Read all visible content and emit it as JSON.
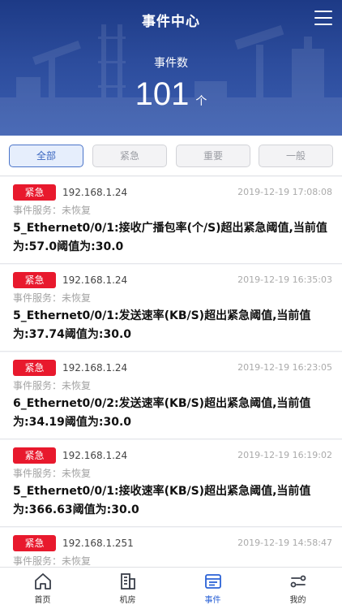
{
  "header": {
    "title": "事件中心",
    "count_label": "事件数",
    "count_value": "101",
    "count_unit": "个"
  },
  "filters": [
    {
      "label": "全部",
      "active": true
    },
    {
      "label": "紧急",
      "active": false
    },
    {
      "label": "重要",
      "active": false
    },
    {
      "label": "一般",
      "active": false
    }
  ],
  "events": [
    {
      "level": "紧急",
      "ip": "192.168.1.24",
      "time": "2019-12-19 17:08:08",
      "service": "事件服务：未恢复",
      "message": "5_Ethernet0/0/1:接收广播包率(个/S)超出紧急阈值,当前值为:57.0阈值为:30.0"
    },
    {
      "level": "紧急",
      "ip": "192.168.1.24",
      "time": "2019-12-19 16:35:03",
      "service": "事件服务：未恢复",
      "message": "5_Ethernet0/0/1:发送速率(KB/S)超出紧急阈值,当前值为:37.74阈值为:30.0"
    },
    {
      "level": "紧急",
      "ip": "192.168.1.24",
      "time": "2019-12-19 16:23:05",
      "service": "事件服务：未恢复",
      "message": "6_Ethernet0/0/2:发送速率(KB/S)超出紧急阈值,当前值为:34.19阈值为:30.0"
    },
    {
      "level": "紧急",
      "ip": "192.168.1.24",
      "time": "2019-12-19 16:19:02",
      "service": "事件服务：未恢复",
      "message": "5_Ethernet0/0/1:接收速率(KB/S)超出紧急阈值,当前值为:366.63阈值为:30.0"
    },
    {
      "level": "紧急",
      "ip": "192.168.1.251",
      "time": "2019-12-19 14:58:47",
      "service": "事件服务：未恢复",
      "message": ""
    }
  ],
  "tabbar": [
    {
      "label": "首页",
      "icon": "home-icon",
      "active": false
    },
    {
      "label": "机房",
      "icon": "building-icon",
      "active": false
    },
    {
      "label": "事件",
      "icon": "event-list-icon",
      "active": true
    },
    {
      "label": "我的",
      "icon": "profile-settings-icon",
      "active": false
    }
  ],
  "colors": {
    "header_top": "#1d3a86",
    "header_bottom": "#3a5db0",
    "urgent_badge": "#e8192d",
    "active_accent": "#2b62d6"
  }
}
